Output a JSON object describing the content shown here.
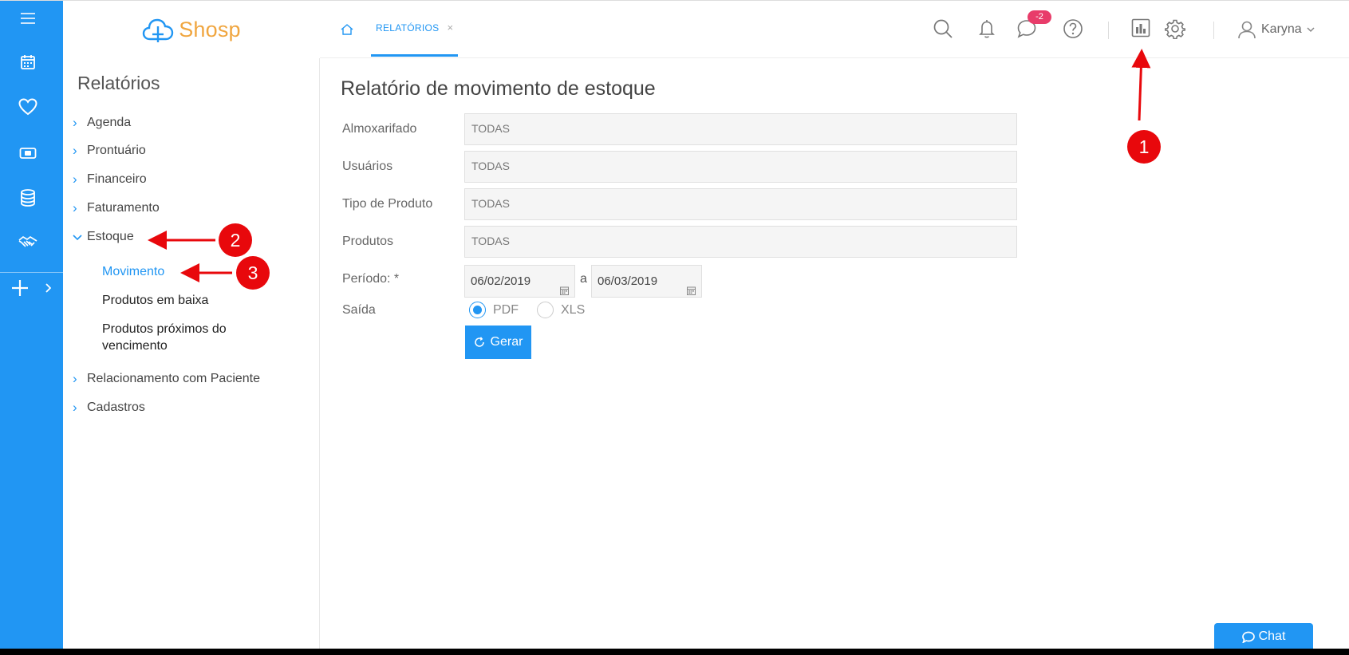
{
  "brand": {
    "name": "Shosp"
  },
  "rail": {
    "icons": [
      "menu-icon",
      "calendar-icon",
      "heart-icon",
      "money-icon",
      "database-icon",
      "handshake-icon",
      "plus-icon",
      "chevron-right-icon"
    ]
  },
  "topbar": {
    "tab_label": "RELATÓRIOS",
    "tab_close": "×",
    "chat_badge": "-2",
    "user_name": "Karyna"
  },
  "sidebar": {
    "title": "Relatórios",
    "items": [
      {
        "label": "Agenda"
      },
      {
        "label": "Prontuário"
      },
      {
        "label": "Financeiro"
      },
      {
        "label": "Faturamento"
      },
      {
        "label": "Estoque"
      },
      {
        "label": "Relacionamento com Paciente"
      },
      {
        "label": "Cadastros"
      }
    ],
    "subitems": [
      {
        "label": "Movimento"
      },
      {
        "label": "Produtos em baixa"
      },
      {
        "label": "Produtos próximos do vencimento"
      }
    ]
  },
  "main": {
    "title": "Relatório de movimento de estoque",
    "fields": [
      {
        "label": "Almoxarifado",
        "value": "TODAS"
      },
      {
        "label": "Usuários",
        "value": "TODAS"
      },
      {
        "label": "Tipo de Produto",
        "value": "TODAS"
      },
      {
        "label": "Produtos",
        "value": "TODAS"
      }
    ],
    "period": {
      "label": "Período: *",
      "start": "06/02/2019",
      "separator": "a",
      "end": "06/03/2019"
    },
    "output": {
      "label": "Saída",
      "options": [
        "PDF",
        "XLS"
      ],
      "selected": "PDF"
    },
    "generate_label": "Gerar"
  },
  "chat": {
    "label": "Chat"
  },
  "annotations": {
    "markers": [
      "1",
      "2",
      "3"
    ],
    "color": "#e8080c"
  },
  "colors": {
    "primary": "#2196f3",
    "brand": "#f0a640",
    "badge": "#e83c6a"
  }
}
